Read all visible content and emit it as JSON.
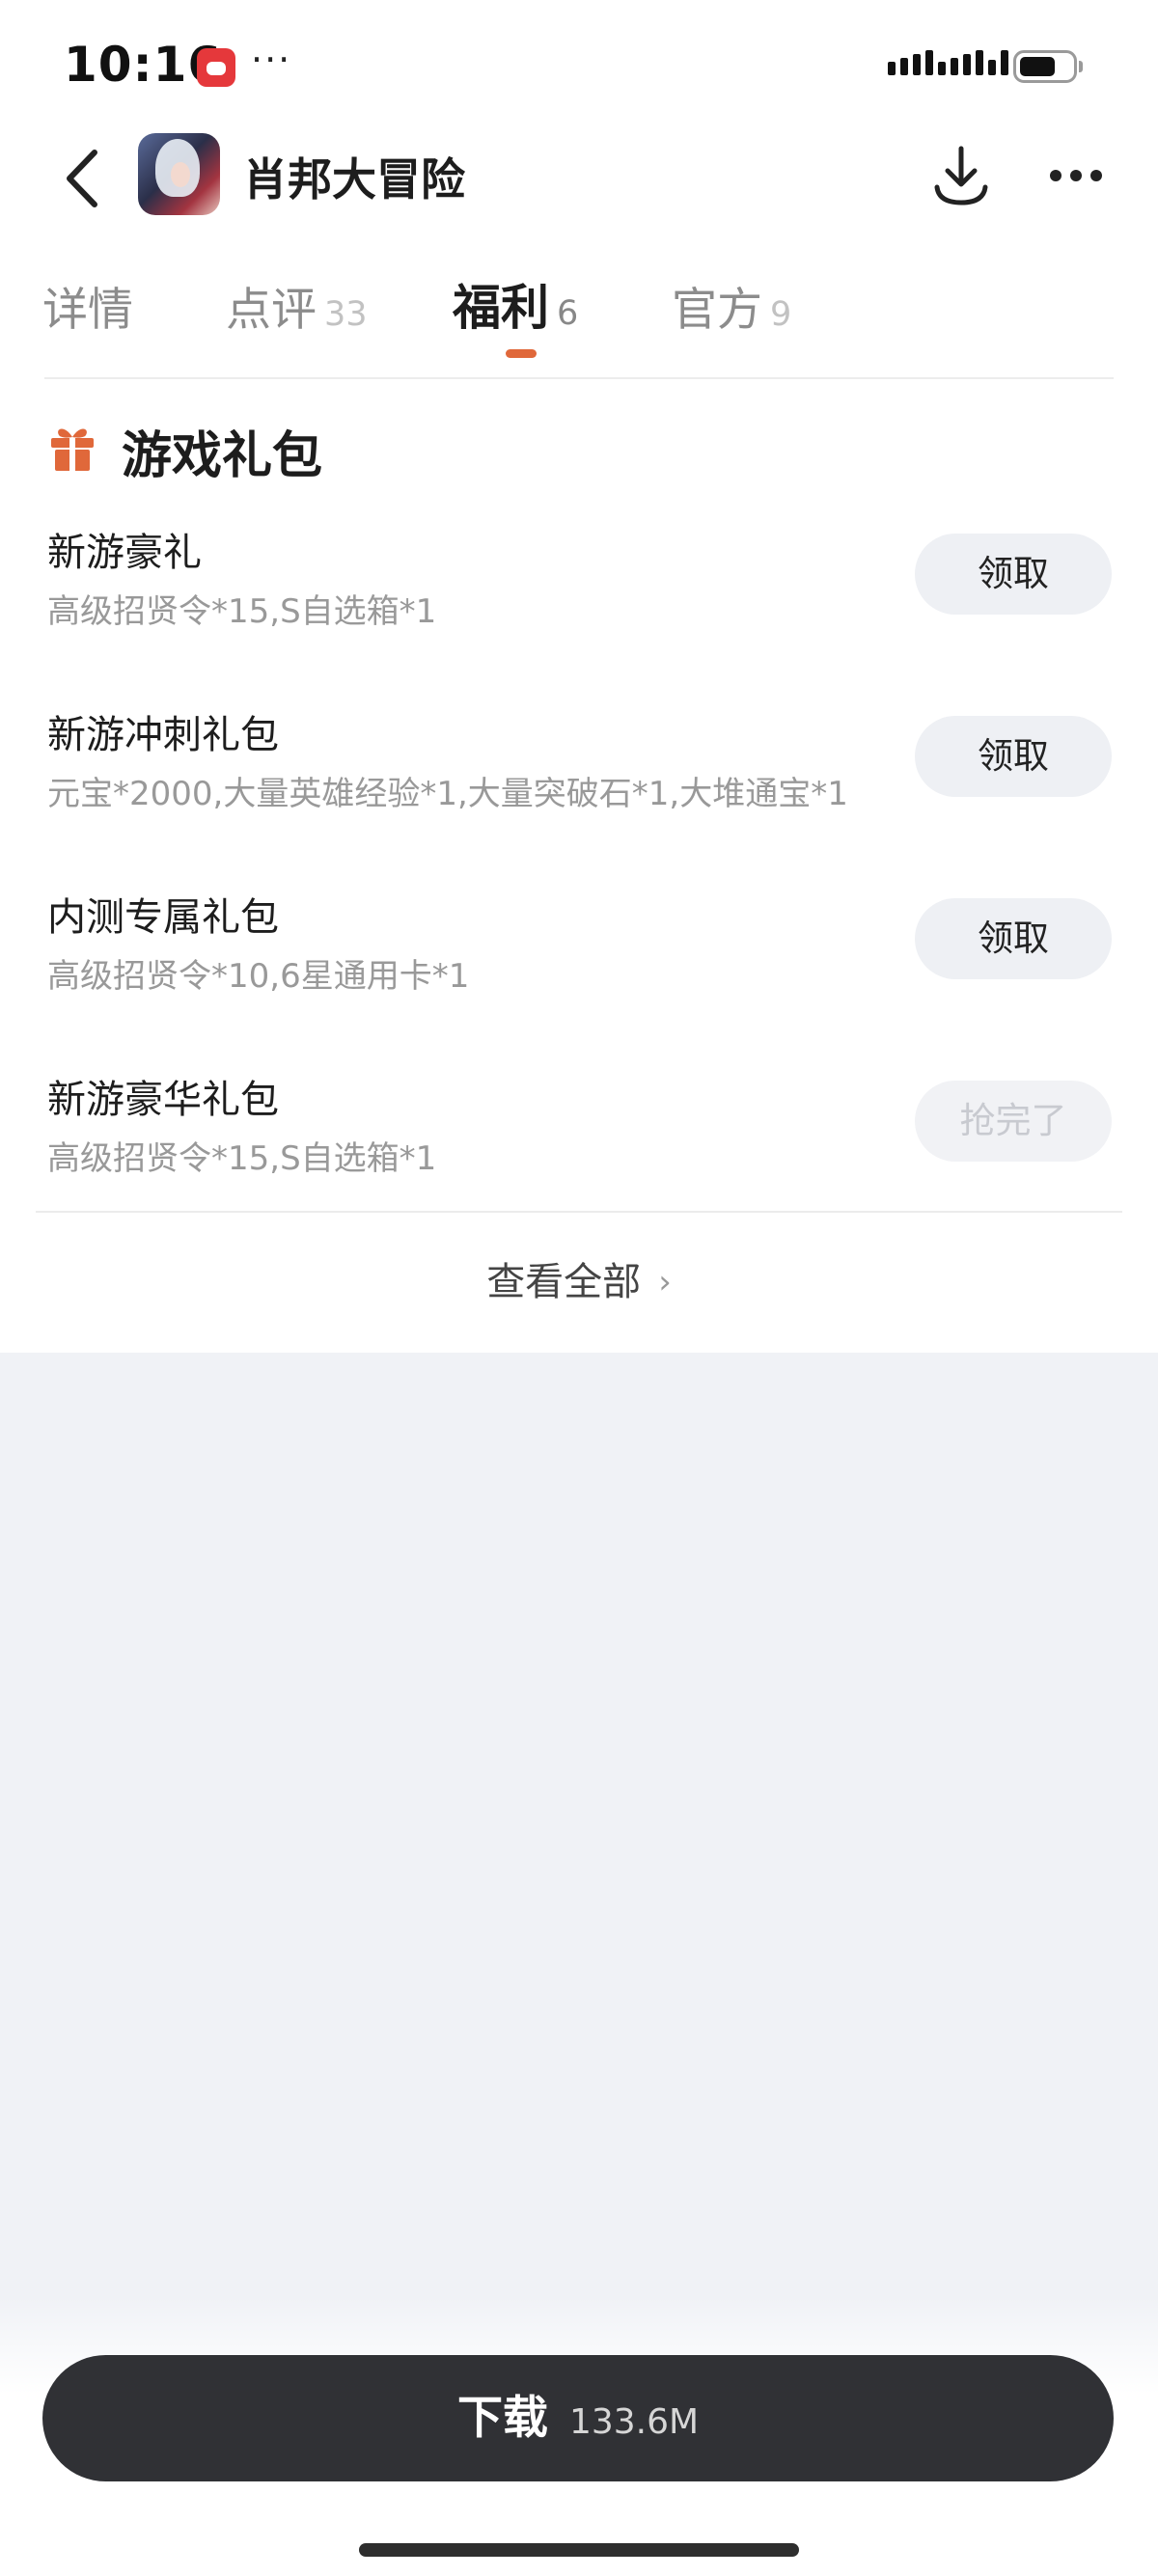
{
  "status_bar": {
    "time": "10:16",
    "more": "···"
  },
  "nav": {
    "game_title": "肖邦大冒险"
  },
  "tabs": [
    {
      "label": "详情",
      "count": ""
    },
    {
      "label": "点评",
      "count": "33"
    },
    {
      "label": "福利",
      "count": "6",
      "active": true
    },
    {
      "label": "官方",
      "count": "9"
    }
  ],
  "section": {
    "title": "游戏礼包"
  },
  "gifts": [
    {
      "name": "新游豪礼",
      "desc": "高级招贤令*15,S自选箱*1",
      "button": "领取",
      "available": true
    },
    {
      "name": "新游冲刺礼包",
      "desc": "元宝*2000,大量英雄经验*1,大量突破石*1,大堆通宝*1",
      "button": "领取",
      "available": true
    },
    {
      "name": "内测专属礼包",
      "desc": "高级招贤令*10,6星通用卡*1",
      "button": "领取",
      "available": true
    },
    {
      "name": "新游豪华礼包",
      "desc": "高级招贤令*15,S自选箱*1",
      "button": "抢完了",
      "available": false
    }
  ],
  "view_all": {
    "label": "查看全部",
    "chevron": "›"
  },
  "download": {
    "label": "下载",
    "size": "133.6M"
  },
  "colors": {
    "accent": "#e0683a",
    "download_bg": "#303135",
    "page_bg": "#f0f2f6"
  }
}
